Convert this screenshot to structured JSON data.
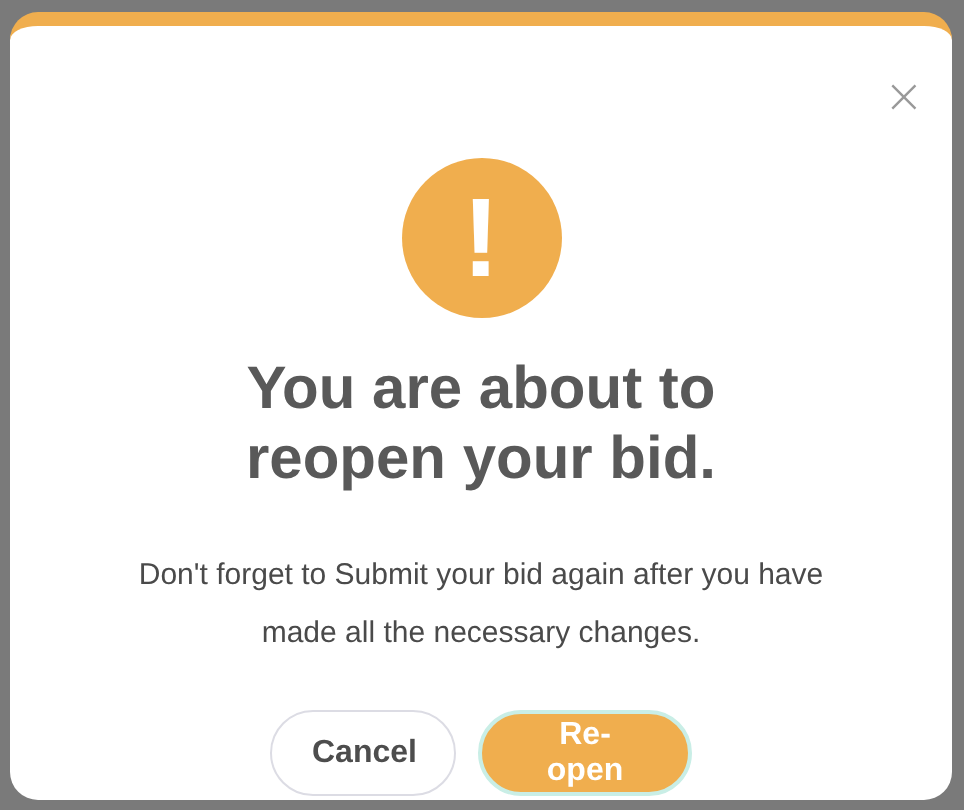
{
  "dialog": {
    "title_lines": [
      "You are about to",
      "reopen your bid."
    ],
    "message_lines": [
      "Don't forget to Submit your bid again after you have",
      "made all the necessary changes."
    ],
    "close": "×",
    "icon": "!",
    "buttons": [
      {
        "label": "Cancel",
        "kind": "secondary"
      },
      {
        "label": "Re-open",
        "kind": "primary"
      }
    ]
  }
}
